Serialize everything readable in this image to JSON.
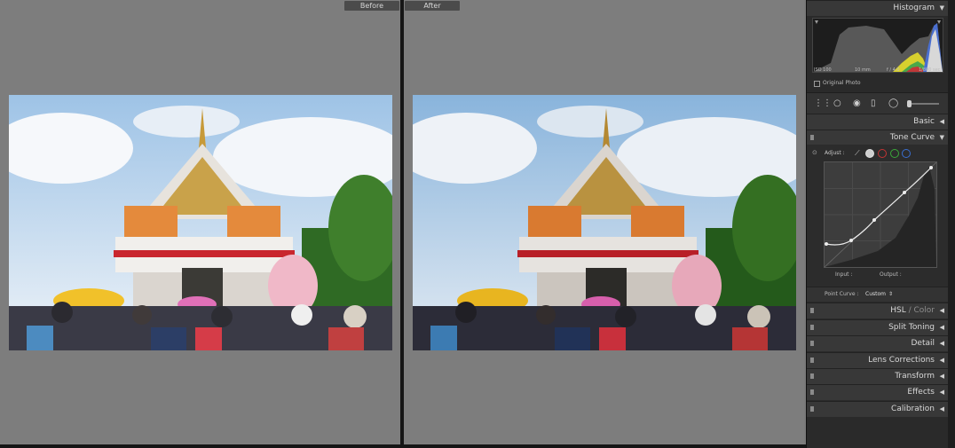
{
  "compare": {
    "before_label": "Before",
    "after_label": "After"
  },
  "panels": {
    "histogram": "Histogram",
    "basic": "Basic",
    "tone_curve": "Tone Curve",
    "hsl": "HSL",
    "color": "Color",
    "split_toning": "Split Toning",
    "detail": "Detail",
    "lens_corrections": "Lens Corrections",
    "transform": "Transform",
    "effects": "Effects",
    "calibration": "Calibration",
    "separator": " / "
  },
  "histogram_info": {
    "iso": "ISO 100",
    "focal": "10 mm",
    "aperture": "f / 4.0",
    "shutter": "1/800 sec",
    "original_photo": "Original Photo"
  },
  "tone_curve": {
    "adjust_label": "Adjust :",
    "input_label": "Input :",
    "output_label": "Output :",
    "point_curve_label": "Point Curve :",
    "point_curve_value": "Custom"
  },
  "icons": {
    "collapse": "triangle-down-icon",
    "expand": "triangle-left-icon"
  }
}
